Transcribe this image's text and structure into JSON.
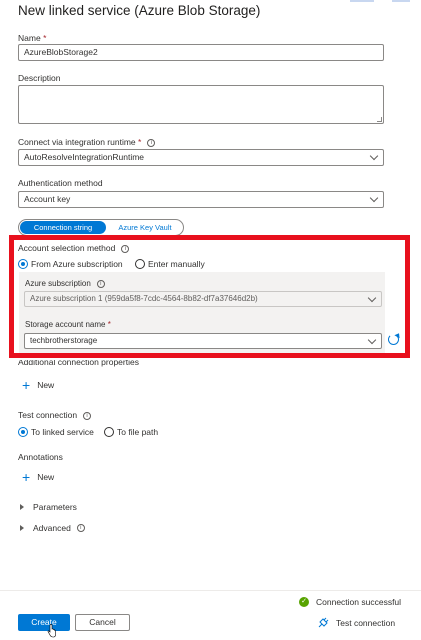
{
  "header": {
    "title": "New linked service (Azure Blob Storage)"
  },
  "name_field": {
    "label": "Name",
    "required_mark": "*",
    "value": "AzureBlobStorage2"
  },
  "description_field": {
    "label": "Description",
    "value": ""
  },
  "runtime_field": {
    "label": "Connect via integration runtime",
    "required_mark": "*",
    "value": "AutoResolveIntegrationRuntime"
  },
  "auth_field": {
    "label": "Authentication method",
    "value": "Account key"
  },
  "auth_toggle": {
    "option_connection_string": "Connection string",
    "option_key_vault": "Azure Key Vault",
    "selected": "Connection string"
  },
  "account_selection": {
    "label": "Account selection method",
    "options": [
      "From Azure subscription",
      "Enter manually"
    ],
    "selected": "From Azure subscription"
  },
  "subscription_field": {
    "label": "Azure subscription",
    "value": "Azure subscription 1 (959da5f8-7cdc-4564-8b82-df7a37646d2b)"
  },
  "storage_field": {
    "label": "Storage account name",
    "required_mark": "*",
    "value": "techbrotherstorage"
  },
  "additional_props": {
    "label": "Additional connection properties",
    "add_label": "New"
  },
  "test_connection": {
    "label": "Test connection",
    "options": [
      "To linked service",
      "To file path"
    ],
    "selected": "To linked service"
  },
  "annotations": {
    "label": "Annotations",
    "add_label": "New"
  },
  "sections": {
    "parameters": "Parameters",
    "advanced": "Advanced"
  },
  "footer": {
    "create_label": "Create",
    "cancel_label": "Cancel",
    "status_text": "Connection successful",
    "test_label": "Test connection"
  },
  "colors": {
    "accent": "#0078d4",
    "highlight_box": "#e8101d",
    "success": "#57a300"
  }
}
